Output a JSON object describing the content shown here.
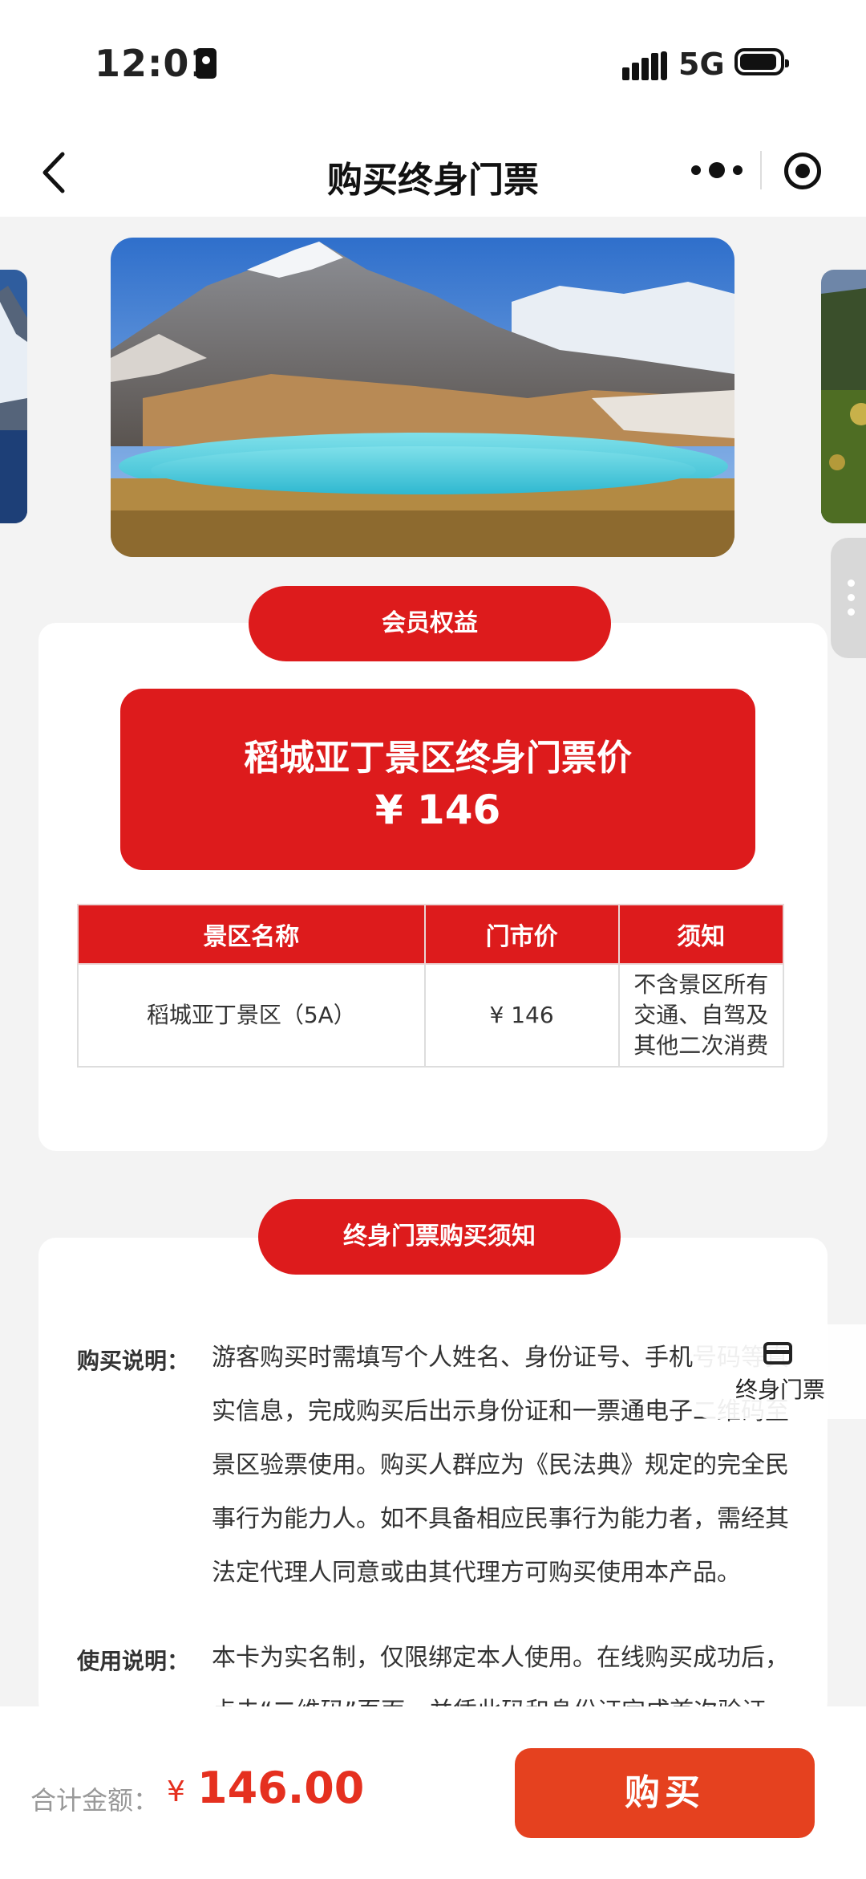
{
  "status_bar": {
    "time": "12:01",
    "network": "5G"
  },
  "nav": {
    "title": "购买终身门票"
  },
  "benefits": {
    "pill_label": "会员权益",
    "price_title": "稻城亚丁景区终身门票价",
    "price_value": "¥ 146"
  },
  "table": {
    "headers": [
      "景区名称",
      "门市价",
      "须知"
    ],
    "rows": [
      {
        "name": "稻城亚丁景区（5A）",
        "price": "¥ 146",
        "notice": "不含景区所有交通、自驾及其他二次消费"
      }
    ]
  },
  "purchase_notice": {
    "pill_label": "终身门票购买须知",
    "items": [
      {
        "label": "购买说明：",
        "text": "游客购买时需填写个人姓名、身份证号、手机号码等真实信息，完成购买后出示身份证和一票通电子二维码至景区验票使用。购买人群应为《民法典》规定的完全民事行为能力人。如不具备相应民事行为能力者，需经其法定代理人同意或由其代理方可购买使用本产品。"
      },
      {
        "label": "使用说明：",
        "text": "本卡为实名制，仅限绑定本人使用。在线购买成功后，点击“二维码”页面，并凭此码和身份证完成首次验证"
      }
    ]
  },
  "floating": {
    "ticket_label": "终身门票"
  },
  "bottom_bar": {
    "total_label": "合计金额：",
    "currency": "¥",
    "amount": "146.00",
    "buy_label": "购买"
  },
  "colors": {
    "brand_red": "#dd1b1c",
    "buy_orange": "#e5411f",
    "price_red": "#e5301f"
  }
}
